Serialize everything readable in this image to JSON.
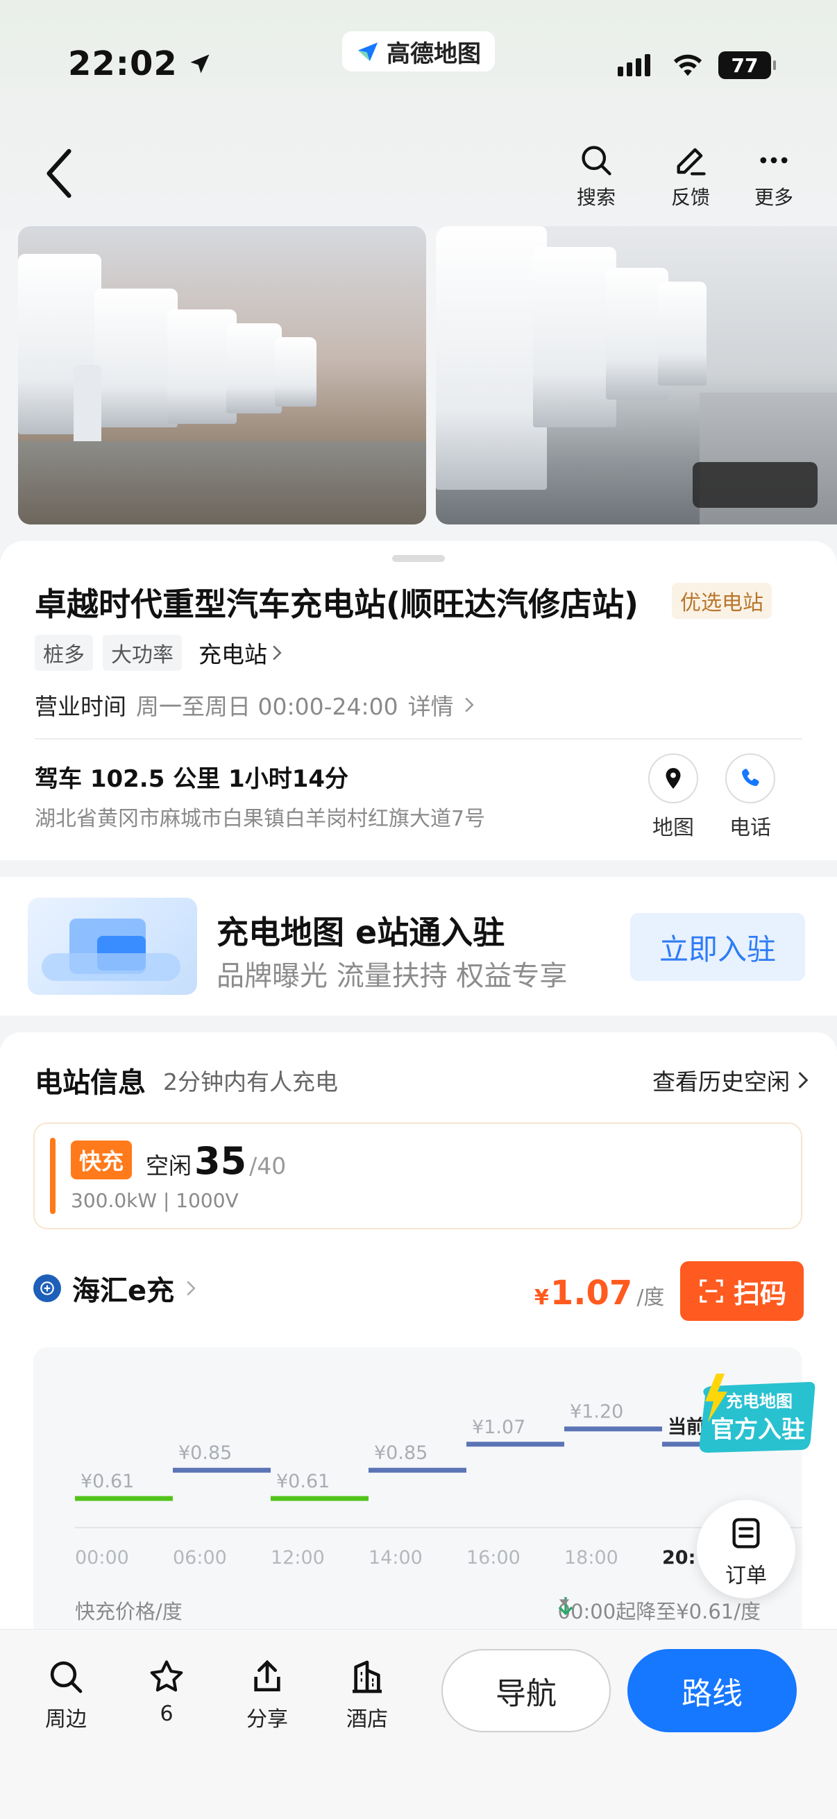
{
  "status_bar": {
    "time": "22:02",
    "app_name": "高德地图",
    "battery": "77"
  },
  "header": {
    "actions": [
      {
        "label": "搜索",
        "icon": "search-icon"
      },
      {
        "label": "反馈",
        "icon": "edit-icon"
      },
      {
        "label": "更多",
        "icon": "more-icon"
      }
    ]
  },
  "station": {
    "name": "卓越时代重型汽车充电站(顺旺达汽修店站)",
    "badge": "优选电站",
    "tags": [
      "桩多",
      "大功率"
    ],
    "category": "充电站",
    "hours_label": "营业时间",
    "hours_value": "周一至周日 00:00-24:00",
    "hours_detail": "详情",
    "drive_info": "驾车 102.5 公里 1小时14分",
    "address": "湖北省黄冈市麻城市白果镇白羊岗村红旗大道7号",
    "map_label": "地图",
    "phone_label": "电话"
  },
  "promo": {
    "title": "充电地图 e站通入驻",
    "subtitle": "品牌曝光 流量扶持 权益专享",
    "button": "立即入驻"
  },
  "station_info": {
    "title": "电站信息",
    "subtitle": "2分钟内有人充电",
    "history_link": "查看历史空闲",
    "fast_tag": "快充",
    "idle_label": "空闲",
    "idle_count": "35",
    "total": "/40",
    "spec": "300.0kW | 1000V",
    "operator": "海汇e充",
    "price_symbol": "¥",
    "price": "1.07",
    "price_unit": "/度",
    "scan_button": "扫码",
    "chart_footer_left": "快充价格/度",
    "chart_footer_right": "00:00起降至¥0.61/度"
  },
  "chart_data": {
    "type": "line",
    "series": [
      {
        "segments": [
          {
            "from": "00:00",
            "to": "06:00",
            "value": 0.61,
            "label": "¥0.61"
          },
          {
            "from": "06:00",
            "to": "12:00",
            "value": 0.85,
            "label": "¥0.85"
          },
          {
            "from": "12:00",
            "to": "14:00",
            "value": 0.61,
            "label": "¥0.61"
          },
          {
            "from": "14:00",
            "to": "16:00",
            "value": 0.85,
            "label": "¥0.85"
          },
          {
            "from": "16:00",
            "to": "18:00",
            "value": 1.07,
            "label": "¥1.07"
          },
          {
            "from": "18:00",
            "to": "20:00",
            "value": 1.2,
            "label": "¥1.20"
          },
          {
            "from": "20:00",
            "to": "22:00",
            "value": 1.07,
            "label": "当前"
          }
        ]
      }
    ],
    "x_ticks": [
      "00:00",
      "06:00",
      "12:00",
      "14:00",
      "16:00",
      "18:00",
      "20:"
    ],
    "colors": {
      "low": "#52c41a",
      "normal": "#5b74b5"
    }
  },
  "official_badge": {
    "line1": "充电地图",
    "line2": "官方入驻"
  },
  "order_fab": {
    "label": "订单"
  },
  "bottom_bar": {
    "tabs": [
      {
        "label": "周边",
        "icon": "search-icon"
      },
      {
        "label": "6",
        "icon": "star-icon"
      },
      {
        "label": "分享",
        "icon": "share-icon"
      },
      {
        "label": "酒店",
        "icon": "hotel-icon"
      }
    ],
    "navigate": "导航",
    "route": "路线"
  }
}
